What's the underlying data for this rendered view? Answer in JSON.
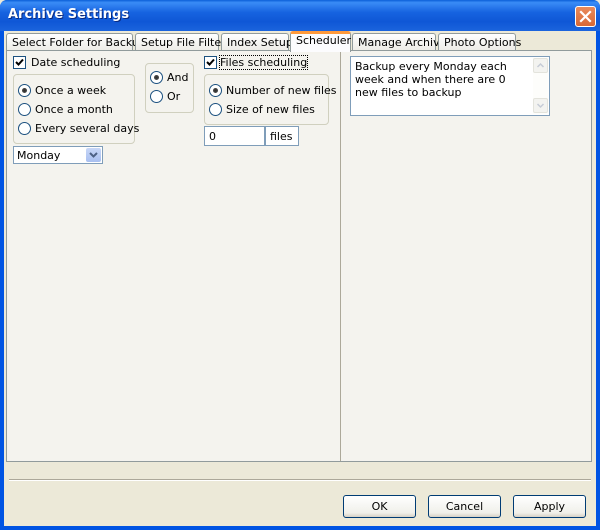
{
  "window": {
    "title": "Archive Settings",
    "close_icon": "close-icon"
  },
  "tabs": [
    {
      "label": "Select Folder for Backup",
      "active": false
    },
    {
      "label": "Setup File Filter",
      "active": false
    },
    {
      "label": "Index Setup",
      "active": false
    },
    {
      "label": "Scheduler",
      "active": true
    },
    {
      "label": "Manage Archive",
      "active": false
    },
    {
      "label": "Photo Options",
      "active": false
    }
  ],
  "scheduler": {
    "date_scheduling": {
      "label": "Date scheduling",
      "checked": true
    },
    "date_options": [
      {
        "label": "Once a week",
        "selected": true
      },
      {
        "label": "Once a month",
        "selected": false
      },
      {
        "label": "Every several days",
        "selected": false
      }
    ],
    "day_select": {
      "value": "Monday"
    },
    "logic_options": [
      {
        "label": "And",
        "selected": true
      },
      {
        "label": "Or",
        "selected": false
      }
    ],
    "files_scheduling": {
      "label": "Files scheduling",
      "checked": true
    },
    "files_options": [
      {
        "label": "Number of new files",
        "selected": true
      },
      {
        "label": "Size of new files",
        "selected": false
      }
    ],
    "files_count": {
      "value": "0",
      "unit": "files"
    },
    "summary": "Backup every Monday each week and when there are 0 new files to backup"
  },
  "buttons": {
    "ok": "OK",
    "cancel": "Cancel",
    "apply": "Apply"
  }
}
